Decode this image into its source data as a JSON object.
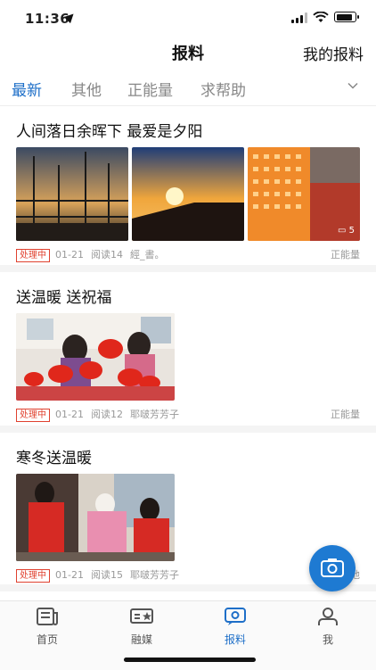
{
  "status": {
    "time": "11:36"
  },
  "header": {
    "title": "报料",
    "mine": "我的报料"
  },
  "tabs": [
    {
      "label": "最新",
      "active": true
    },
    {
      "label": "其他"
    },
    {
      "label": "正能量"
    },
    {
      "label": "求帮助"
    }
  ],
  "posts": [
    {
      "title": "人间落日余晖下 最爱是夕阳",
      "status": "处理中",
      "date": "01-21",
      "reads": "阅读14",
      "author": "經_書。",
      "category": "正能量",
      "image_count": "5"
    },
    {
      "title": "送温暖 送祝福",
      "status": "处理中",
      "date": "01-21",
      "reads": "阅读12",
      "author": "耶啵芳芳子",
      "category": "正能量"
    },
    {
      "title": "寒冬送温暖",
      "status": "处理中",
      "date": "01-21",
      "reads": "阅读15",
      "author": "耶啵芳芳子",
      "category": "他"
    }
  ],
  "nav": [
    {
      "label": "首页",
      "icon": "newspaper-icon"
    },
    {
      "label": "融媒",
      "icon": "tv-star-icon"
    },
    {
      "label": "报料",
      "icon": "report-chat-icon",
      "active": true
    },
    {
      "label": "我",
      "icon": "person-icon"
    }
  ],
  "colors": {
    "accent": "#1e6fc8",
    "badge": "#e0412f"
  }
}
